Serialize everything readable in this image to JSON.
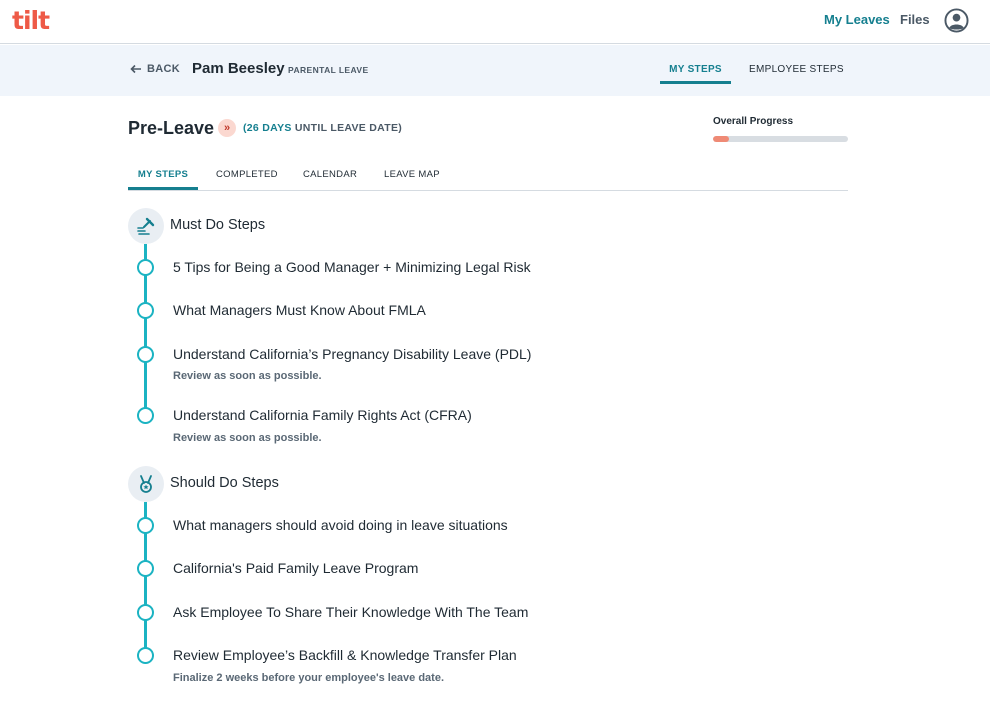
{
  "topnav": {
    "logo": "tilt",
    "my_leaves": "My Leaves",
    "files": "Files"
  },
  "subheader": {
    "back_label": "BACK",
    "person_name": "Pam Beesley",
    "leave_type": "PARENTAL LEAVE",
    "tabs": [
      {
        "label": "MY STEPS",
        "active": true
      },
      {
        "label": "EMPLOYEE STEPS",
        "active": false
      }
    ]
  },
  "phase": {
    "title": "Pre-Leave",
    "badge_icon": "»",
    "days_prefix": "(",
    "days_number": "26 DAYS",
    "days_suffix": " UNTIL LEAVE DATE)",
    "progress_label": "Overall Progress",
    "progress_percent": 12
  },
  "tabs": [
    {
      "label": "MY STEPS",
      "active": true
    },
    {
      "label": "COMPLETED",
      "active": false
    },
    {
      "label": "CALENDAR",
      "active": false
    },
    {
      "label": "LEAVE MAP",
      "active": false
    }
  ],
  "sections": {
    "must": {
      "title": "Must Do Steps",
      "icon": "gavel-icon",
      "steps": [
        {
          "title": "5 Tips for Being a Good Manager + Minimizing Legal Risk"
        },
        {
          "title": "What Managers Must Know About FMLA"
        },
        {
          "title": "Understand California’s Pregnancy Disability Leave (PDL)",
          "note": "Review as soon as possible."
        },
        {
          "title": "Understand California Family Rights Act (CFRA)",
          "note": "Review as soon as possible."
        }
      ]
    },
    "should": {
      "title": "Should Do Steps",
      "icon": "medal-icon",
      "steps": [
        {
          "title": "What managers should avoid doing in leave situations"
        },
        {
          "title": "California's Paid Family Leave Program"
        },
        {
          "title": "Ask Employee To Share Their Knowledge With The Team"
        },
        {
          "title": "Review Employee’s Backfill & Knowledge Transfer Plan",
          "note": "Finalize 2 weeks before your employee's leave date."
        }
      ]
    }
  },
  "colors": {
    "accent": "#157f8f",
    "timeline": "#1bb3c2",
    "brand": "#ee5a47",
    "progress_fill": "#ef8a75"
  }
}
